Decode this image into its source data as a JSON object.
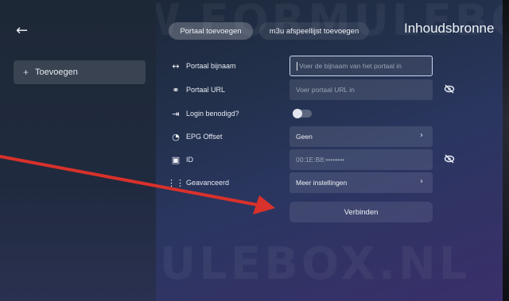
{
  "watermark": {
    "top": "WWW.FORMULEBOX.NL",
    "bottom": "FORMULEBOX.NL"
  },
  "nav": {
    "back_icon": "arrow-left-icon"
  },
  "sidebar": {
    "items": [
      {
        "icon": "plus-icon",
        "label": "Toevoegen"
      }
    ]
  },
  "tabs": [
    {
      "label": "Portaal toevoegen",
      "active": true
    },
    {
      "label": "m3u afspeellijst toevoegen",
      "active": false
    }
  ],
  "page_title": "Inhoudsbronne",
  "form": {
    "rows": [
      {
        "icon": "arrows-horizontal-icon",
        "label": "Portaal bijnaam",
        "placeholder": "Voer de bijnaam van het portaal in"
      },
      {
        "icon": "link-icon",
        "label": "Portaal URL",
        "placeholder": "Voer portaal URL in"
      },
      {
        "icon": "login-icon",
        "label": "Login benodigd?"
      },
      {
        "icon": "clock-icon",
        "label": "EPG Offset",
        "value": "Geen"
      },
      {
        "icon": "chip-icon",
        "label": "ID",
        "value": "00:1E:B8:••••••••"
      },
      {
        "icon": "sliders-icon",
        "label": "Geavanceerd",
        "value": "Meer instellingen"
      }
    ],
    "connect_label": "Verbinden"
  },
  "annotation": {
    "color": "#d9312b"
  },
  "colors": {
    "accent": "#c8d6f2",
    "annotation_arrow": "#d9312b"
  }
}
